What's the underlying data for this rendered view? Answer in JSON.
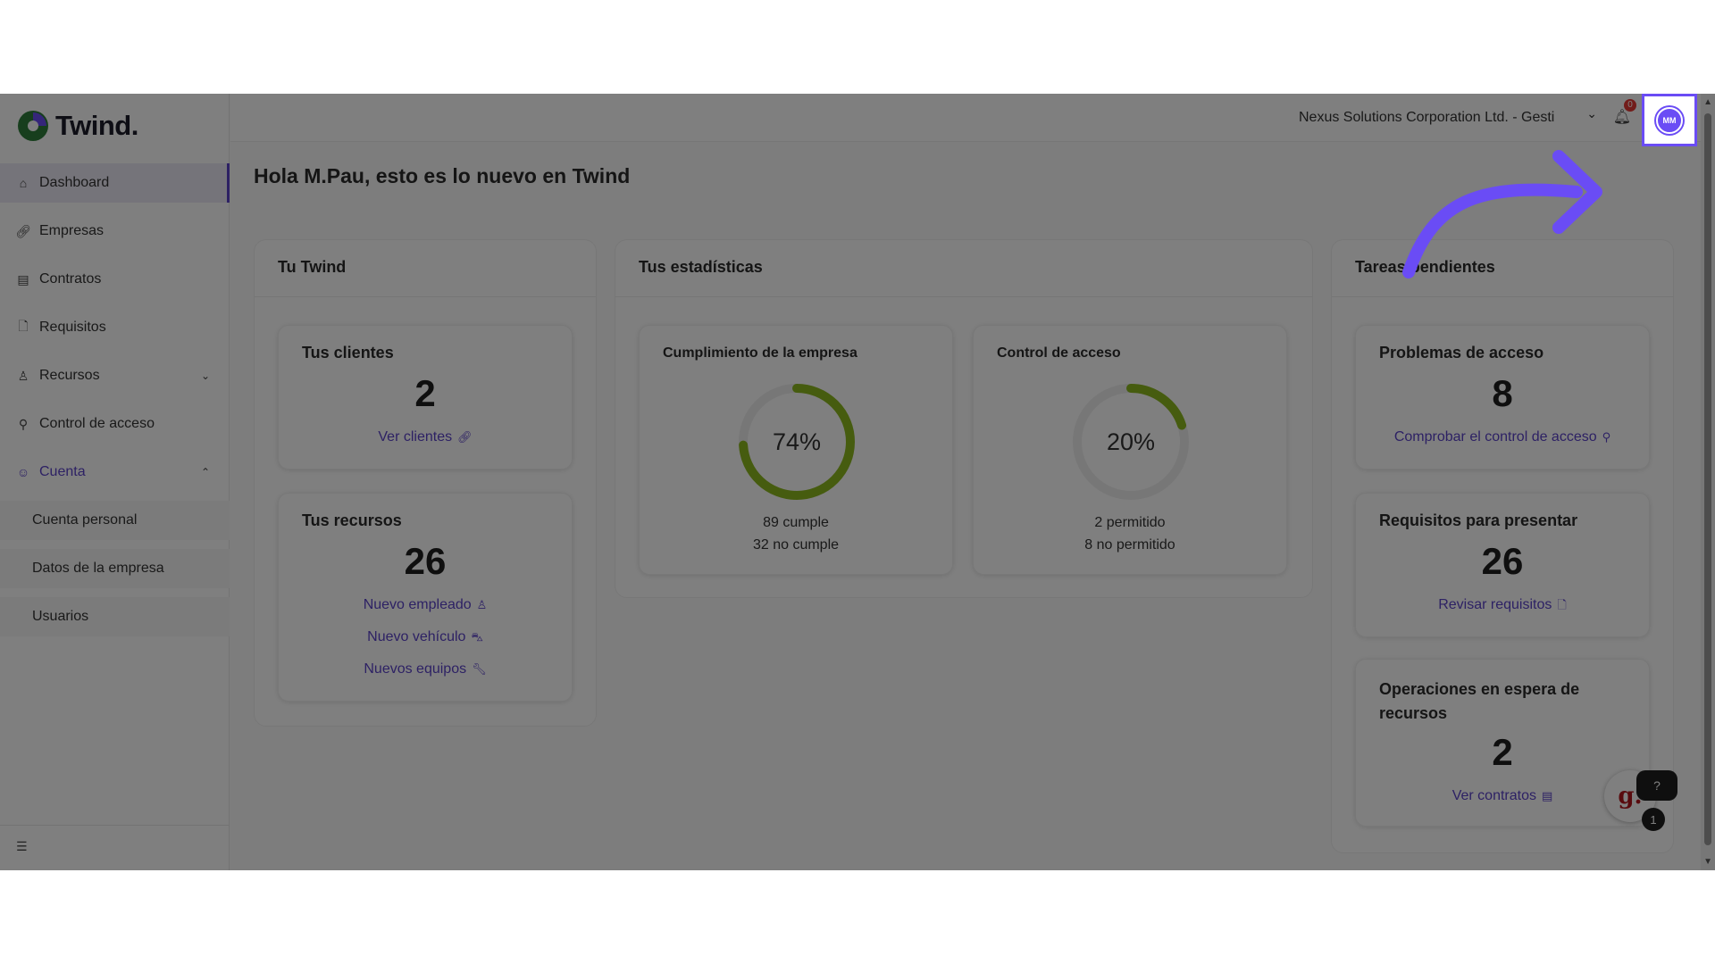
{
  "app": {
    "brand": "Twind."
  },
  "sidebar": {
    "items": [
      {
        "label": "Dashboard",
        "icon": "home-icon"
      },
      {
        "label": "Empresas",
        "icon": "link-icon"
      },
      {
        "label": "Contratos",
        "icon": "contract-icon"
      },
      {
        "label": "Requisitos",
        "icon": "document-icon"
      },
      {
        "label": "Recursos",
        "icon": "users-icon"
      },
      {
        "label": "Control de acceso",
        "icon": "key-icon"
      },
      {
        "label": "Cuenta",
        "icon": "account-icon"
      }
    ],
    "sub_items": [
      {
        "label": "Cuenta personal"
      },
      {
        "label": "Datos de la empresa"
      },
      {
        "label": "Usuarios"
      }
    ]
  },
  "topbar": {
    "company": "Nexus Solutions Corporation Ltd. - Gesti",
    "notifications": "0",
    "avatar_initials": "MM"
  },
  "greeting": "Hola M.Pau, esto es lo nuevo en Twind",
  "tu_twind": {
    "title": "Tu Twind",
    "clientes": {
      "title": "Tus clientes",
      "value": "2",
      "link": "Ver clientes"
    },
    "recursos": {
      "title": "Tus recursos",
      "value": "26",
      "links": [
        "Nuevo empleado",
        "Nuevo vehículo",
        "Nuevos equipos"
      ]
    }
  },
  "estadisticas": {
    "title": "Tus estadísticas",
    "cumplimiento": {
      "title": "Cumplimiento de la empresa",
      "percent": 74,
      "label": "74%",
      "line1": "89 cumple",
      "line2": "32 no cumple"
    },
    "control": {
      "title": "Control de acceso",
      "percent": 20,
      "label": "20%",
      "line1": "2 permitido",
      "line2": "8 no permitido"
    }
  },
  "tareas": {
    "title": "Tareas pendientes",
    "problemas": {
      "title": "Problemas de acceso",
      "value": "8",
      "link": "Comprobar el control de acceso"
    },
    "requisitos": {
      "title": "Requisitos para presentar",
      "value": "26",
      "link": "Revisar requisitos"
    },
    "operaciones": {
      "title": "Operaciones en espera de recursos",
      "value": "2",
      "link": "Ver contratos"
    }
  },
  "help": {
    "count": "1",
    "logo": "g."
  },
  "colors": {
    "accent": "#5b43c9",
    "highlight": "#6a4cf5",
    "donut": "#8db81e"
  }
}
